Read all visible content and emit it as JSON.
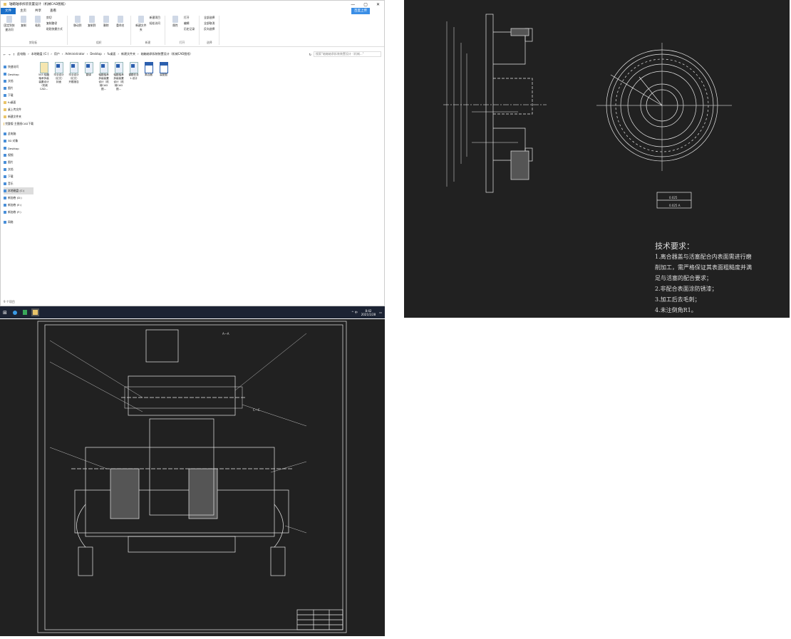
{
  "explorer": {
    "title": "轴箱轴承拆装装置设计（机械CAD图纸）",
    "window_controls": [
      "—",
      "▢",
      "✕"
    ],
    "tabs": [
      "文件",
      "主页",
      "共享",
      "查看"
    ],
    "cloud_button": "百度上传",
    "ribbon": {
      "groups": [
        {
          "label": "剪贴板",
          "buttons": [
            "固定到快速访问",
            "复制",
            "粘贴"
          ],
          "small": [
            "剪切",
            "复制路径",
            "粘贴快捷方式"
          ]
        },
        {
          "label": "组织",
          "buttons": [
            "移动到",
            "复制到",
            "删除",
            "重命名"
          ],
          "small": []
        },
        {
          "label": "新建",
          "buttons": [
            "新建文件夹"
          ],
          "small": [
            "新建项目",
            "轻松访问"
          ]
        },
        {
          "label": "打开",
          "buttons": [
            "属性"
          ],
          "small": [
            "打开",
            "编辑",
            "历史记录"
          ]
        },
        {
          "label": "选择",
          "buttons": [],
          "small": [
            "全部选择",
            "全部取消",
            "反向选择"
          ]
        }
      ]
    },
    "breadcrumb": [
      "此电脑",
      "本地磁盘 (C:)",
      "用户",
      "Administrator",
      "Desktop",
      "fu桌面",
      "新建文件夹",
      "轴箱轴承拆装装置设计（机械CAD图纸）"
    ],
    "search_placeholder": "搜索\"轴箱轴承拆装装置设计（机械...\"",
    "sidebar": [
      {
        "label": "快速访问",
        "icon": "star-icon"
      },
      {
        "label": "Desktop",
        "icon": "desktop-icon"
      },
      {
        "label": "文档",
        "icon": "document-icon"
      },
      {
        "label": "图片",
        "icon": "picture-icon"
      },
      {
        "label": "下载",
        "icon": "download-icon"
      },
      {
        "label": "fu桌面",
        "icon": "folder-icon"
      },
      {
        "label": "桌上传文件",
        "icon": "folder-icon"
      },
      {
        "label": "新建文件夹",
        "icon": "folder-icon"
      },
      {
        "label": "完整版 主图纸CAD下载",
        "icon": "folder-icon"
      },
      {
        "label": "此电脑",
        "icon": "computer-icon"
      },
      {
        "label": "3D 对象",
        "icon": "cube-icon"
      },
      {
        "label": "Desktop",
        "icon": "desktop-icon"
      },
      {
        "label": "视频",
        "icon": "video-icon"
      },
      {
        "label": "图片",
        "icon": "picture-icon"
      },
      {
        "label": "文档",
        "icon": "document-icon"
      },
      {
        "label": "下载",
        "icon": "download-icon"
      },
      {
        "label": "音乐",
        "icon": "music-icon"
      },
      {
        "label": "本地磁盘 (C:)",
        "icon": "drive-icon",
        "selected": true
      },
      {
        "label": "新加卷 (D:)",
        "icon": "drive-icon"
      },
      {
        "label": "新加卷 (E:)",
        "icon": "drive-icon"
      },
      {
        "label": "新加卷 (F:)",
        "icon": "drive-icon"
      },
      {
        "label": "网络",
        "icon": "network-icon"
      }
    ],
    "files": [
      {
        "name": "545 轴箱轴承拆装装置设计（机械CAD...",
        "type": "zip"
      },
      {
        "name": "毕业设计（论文）封面",
        "type": "word"
      },
      {
        "name": "毕业设计（论文）开题报告",
        "type": "word"
      },
      {
        "name": "翻译",
        "type": "word"
      },
      {
        "name": "轴箱轴承拆装装置设计（机械CAD图...",
        "type": "word"
      },
      {
        "name": "轴箱轴承拆装装置设计（机械CAD图...",
        "type": "word"
      },
      {
        "name": "课题任务1-设计",
        "type": "word"
      },
      {
        "name": "离合器",
        "type": "dwg"
      },
      {
        "name": "装配图",
        "type": "dwg"
      }
    ],
    "status": "9 个项目"
  },
  "taskbar": {
    "time": "8:42",
    "date": "2021/1/28",
    "tray": "^ 中"
  },
  "cad_part": {
    "requirements_title": "技术要求：",
    "requirements": [
      "1.离合器盖与活塞配合内表面需进行磨",
      "削加工，需严格保证其表面粗糙度并满",
      "足与活塞的配合要求；",
      "2.非配合表面涂防锈漆；",
      "3.加工后去毛刺；",
      "4.未注倒角R1。"
    ],
    "tolerance": [
      "0.025",
      "0.025 A"
    ]
  },
  "cad_assembly": {
    "section_label": "A—A",
    "view_label": "C—C"
  },
  "colors": {
    "cad_bg": "#212121",
    "accent": "#1a6fc9",
    "taskbar": "#1c2333"
  }
}
